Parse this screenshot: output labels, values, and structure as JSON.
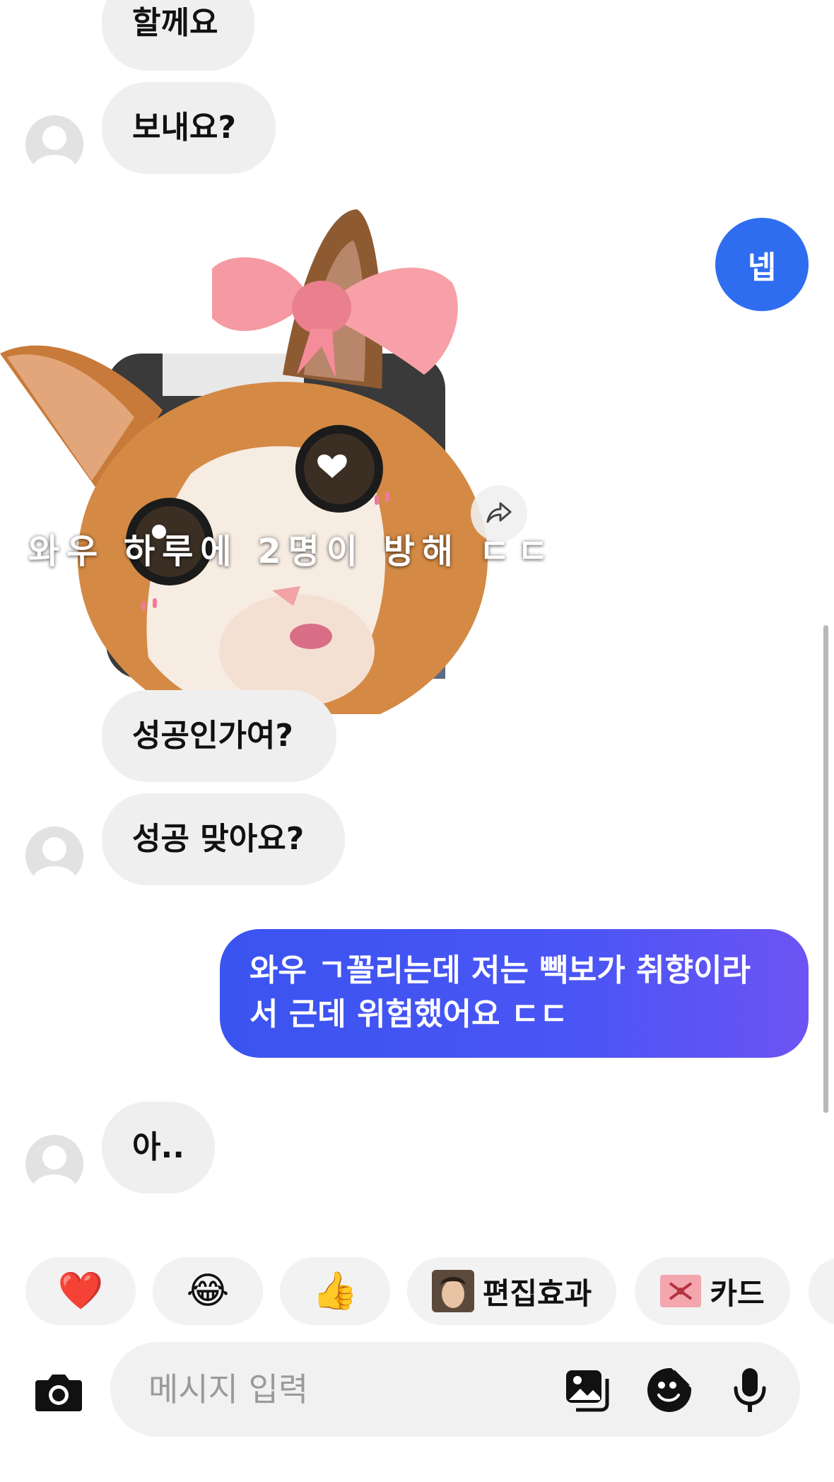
{
  "messages": {
    "m1": "할께요",
    "m2": "보내요?",
    "m3": "넵",
    "sticker_caption": "와우 하루에 2명이 방해 ㄷㄷ",
    "m4": "성공인가여?",
    "m5": "성공 맞아요?",
    "m6": "와우 ㄱ꼴리는데 저는 빽보가 취향이라서 근데 위험했어요 ㄷㄷ",
    "m7": "아.."
  },
  "quick_reactions": [
    {
      "emoji": "❤️",
      "icon": "heart-icon"
    },
    {
      "emoji": "😂",
      "icon": "laughing-tears-icon"
    },
    {
      "emoji": "👍",
      "icon": "thumbs-up-icon"
    }
  ],
  "chips": {
    "effects_label": "편집효과",
    "card_label": "카드"
  },
  "composer": {
    "placeholder": "메시지 입력"
  },
  "colors": {
    "outgoing_blue": "#2f6df0",
    "outgoing_gradient_end": "#6c54f3",
    "incoming_gray": "#efefef"
  }
}
